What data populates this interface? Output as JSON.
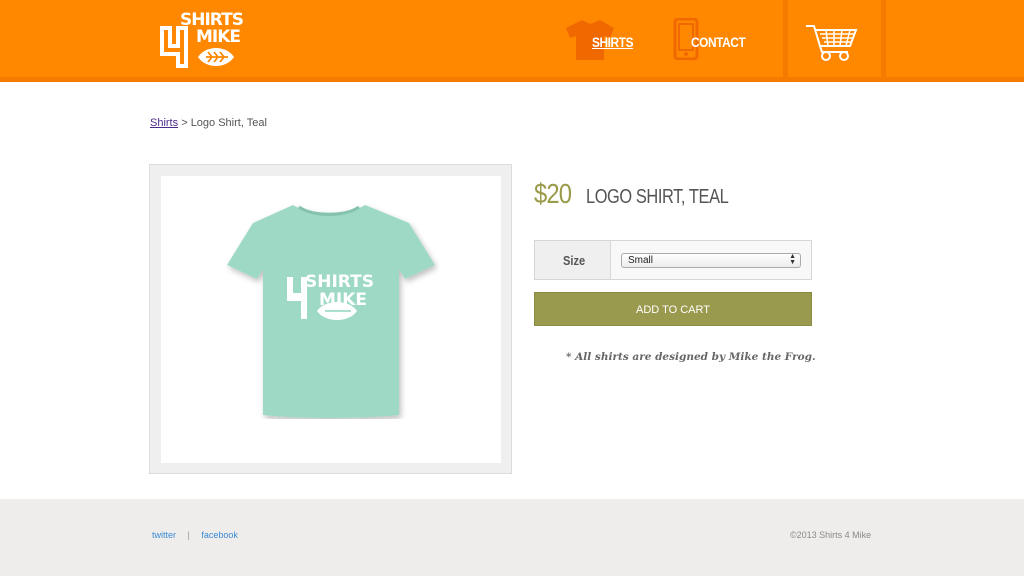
{
  "header": {
    "logo": {
      "line1": "SHIRTS",
      "line2": "MIKE"
    },
    "nav": [
      {
        "label": "SHIRTS",
        "icon": "tshirt-icon",
        "active": true
      },
      {
        "label": "CONTACT",
        "icon": "phone-icon",
        "active": false
      }
    ],
    "cart_icon": "shopping-cart-icon"
  },
  "breadcrumb": {
    "link": "Shirts",
    "separator": ">",
    "current": "Logo Shirt, Teal"
  },
  "product": {
    "price": "$20",
    "title": "LOGO SHIRT, TEAL",
    "size_label": "Size",
    "size_selected": "Small",
    "add_to_cart": "ADD TO CART",
    "note": "* All shirts are designed by Mike the Frog.",
    "image": {
      "shirt_logo_line1": "SHIRTS",
      "shirt_logo_line2": "MIKE"
    }
  },
  "footer": {
    "links": [
      "twitter",
      "facebook"
    ],
    "separator": "|",
    "copyright": "©2013 Shirts 4 Mike"
  },
  "colors": {
    "header_orange": "#ff8800",
    "accent_olive": "#9a9a4e",
    "shirt_teal": "#9ed9c6"
  }
}
